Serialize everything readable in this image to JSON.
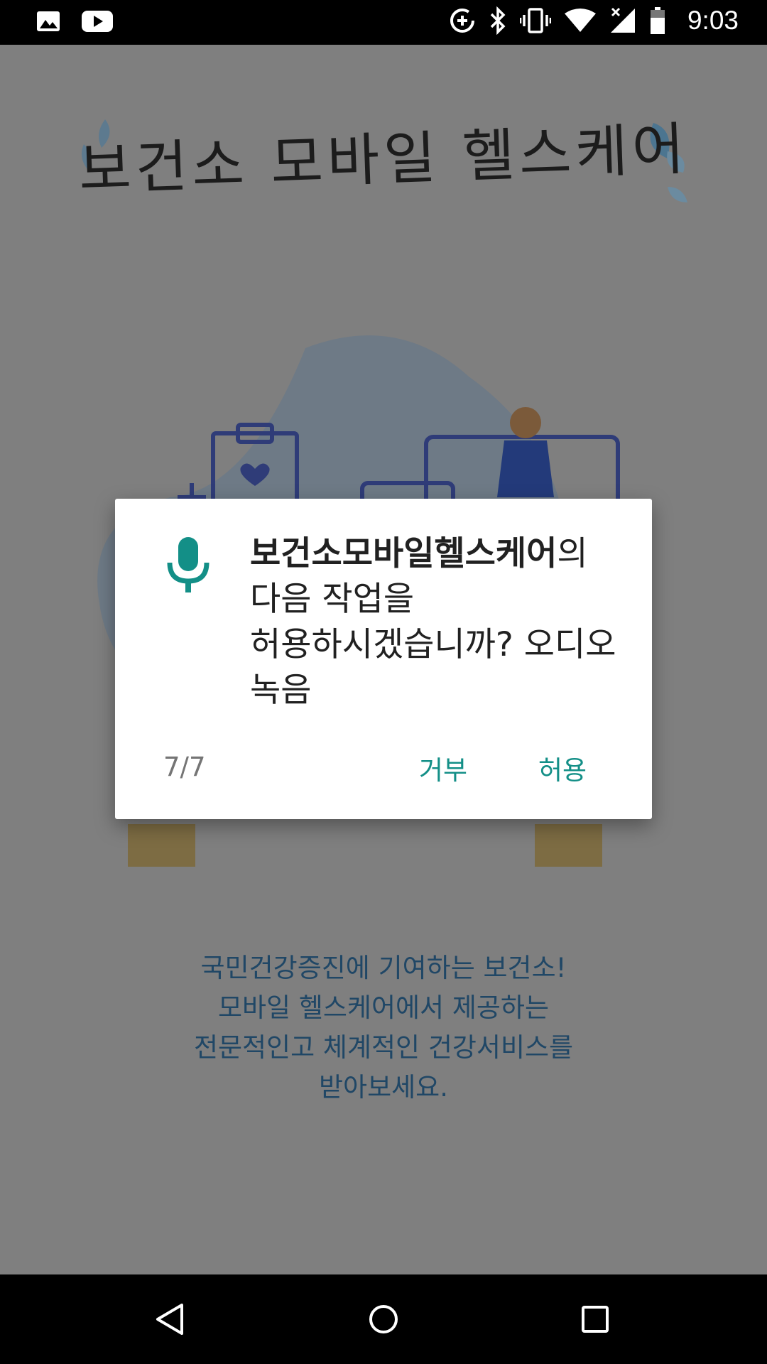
{
  "status_bar": {
    "time": "9:03",
    "left_icons": [
      "image-icon",
      "youtube-icon"
    ],
    "right_icons": [
      "data-saver-icon",
      "bluetooth-icon",
      "vibrate-icon",
      "wifi-icon",
      "signal-no-data-icon",
      "battery-icon"
    ]
  },
  "app": {
    "title": "보건소 모바일 헬스케어",
    "description_lines": [
      "국민건강증진에 기여하는 보건소!",
      "모바일 헬스케어에서 제공하는",
      "전문적인고 체계적인 건강서비스를",
      "받아보세요."
    ]
  },
  "dialog": {
    "icon": "microphone-icon",
    "app_name": "보건소모바일헬스케어",
    "message": "의 다음 작업을 허용하시겠습니까? 오디오 녹음",
    "counter": "7/7",
    "deny_label": "거부",
    "allow_label": "허용"
  },
  "colors": {
    "accent": "#138f87",
    "scrim": "#7f7f7f",
    "dialog_bg": "#ffffff"
  },
  "nav_bar": {
    "buttons": [
      "back-icon",
      "home-icon",
      "recents-icon"
    ]
  }
}
